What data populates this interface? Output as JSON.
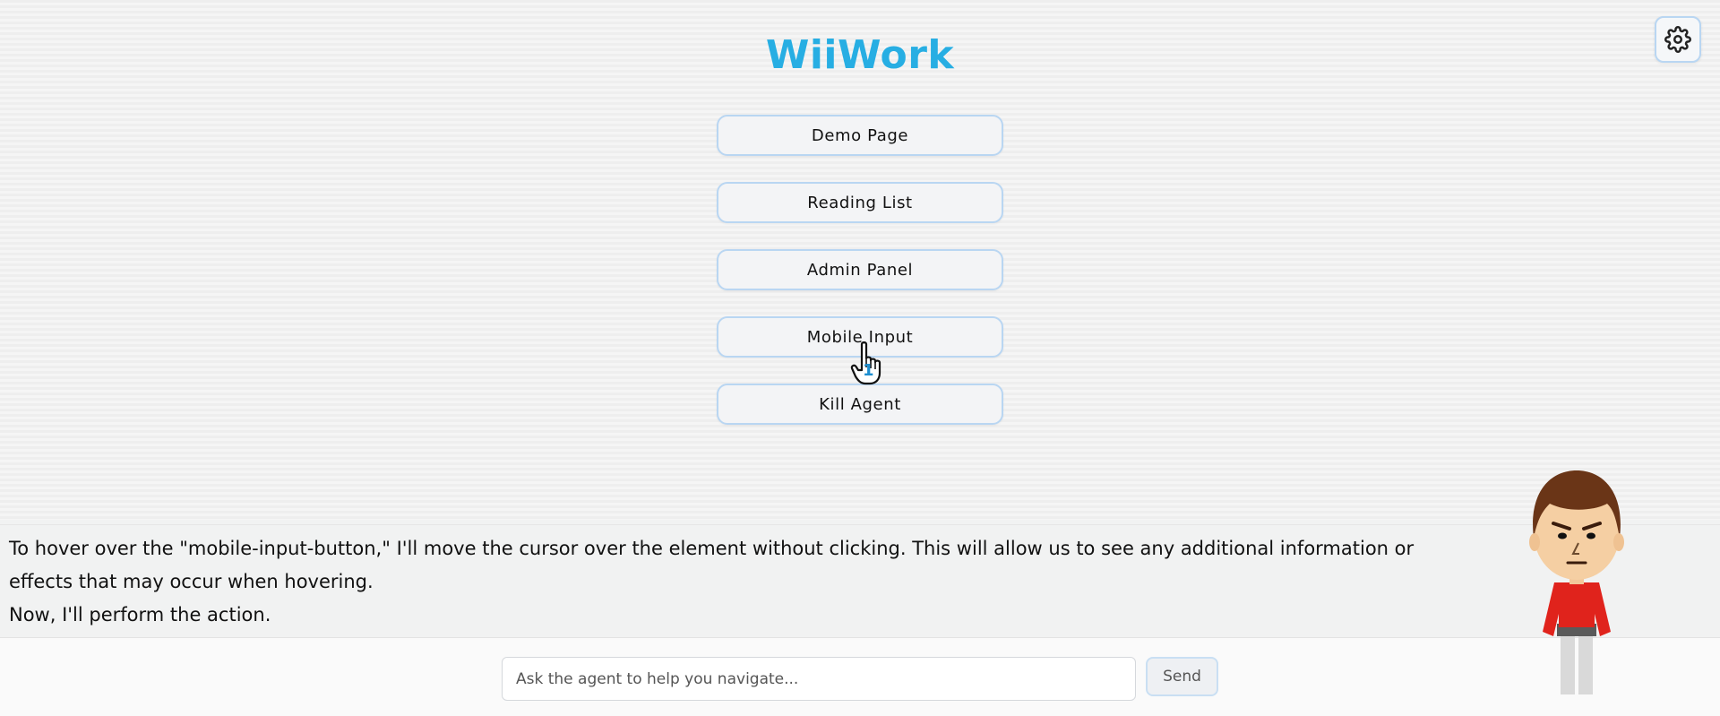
{
  "app": {
    "title": "WiiWork"
  },
  "settings": {
    "icon": "gear-icon"
  },
  "menu": {
    "items": [
      {
        "label": "Demo Page"
      },
      {
        "label": "Reading List"
      },
      {
        "label": "Admin Panel"
      },
      {
        "label": "Mobile Input"
      },
      {
        "label": "Kill Agent"
      }
    ]
  },
  "cursor": {
    "icon": "hand-pointer-icon",
    "number": "1"
  },
  "transcript": {
    "line1": "To hover over the \"mobile-input-button,\" I'll move the cursor over the element without clicking. This will allow us to see any additional information or effects that may occur when hovering.",
    "line2": "Now, I'll perform the action."
  },
  "chat": {
    "placeholder": "Ask the agent to help you navigate...",
    "send_label": "Send"
  },
  "colors": {
    "accent": "#27aee3",
    "button_border": "#b9d6f2",
    "mii_shirt": "#e0231c"
  }
}
